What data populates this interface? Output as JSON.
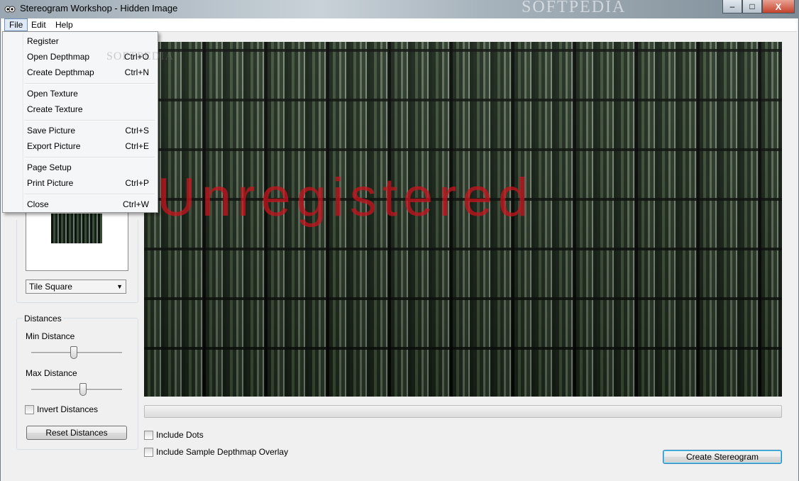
{
  "window": {
    "title": "Stereogram Workshop - Hidden Image",
    "watermark": "SOFTPEDIA",
    "min_glyph": "–",
    "max_glyph": "□",
    "close_glyph": "X"
  },
  "menubar": {
    "file": "File",
    "edit": "Edit",
    "help": "Help"
  },
  "file_menu": {
    "register": "Register",
    "open_depthmap": "Open Depthmap",
    "open_depthmap_sc": "Ctrl+O",
    "create_depthmap": "Create Depthmap",
    "create_depthmap_sc": "Ctrl+N",
    "open_texture": "Open Texture",
    "create_texture": "Create Texture",
    "save_picture": "Save Picture",
    "save_picture_sc": "Ctrl+S",
    "export_picture": "Export Picture",
    "export_picture_sc": "Ctrl+E",
    "page_setup": "Page Setup",
    "print_picture": "Print Picture",
    "print_picture_sc": "Ctrl+P",
    "close": "Close",
    "close_sc": "Ctrl+W"
  },
  "texture": {
    "tile_mode": "Tile Square"
  },
  "distances": {
    "legend": "Distances",
    "min_label": "Min Distance",
    "min_value": 0.47,
    "max_label": "Max Distance",
    "max_value": 0.58,
    "invert_label": "Invert Distances",
    "invert_checked": false,
    "reset_label": "Reset Distances"
  },
  "preview": {
    "watermark": "Unregistered",
    "progress": 0
  },
  "options": {
    "include_dots": "Include Dots",
    "include_dots_checked": false,
    "include_overlay": "Include Sample Depthmap Overlay",
    "include_overlay_checked": false
  },
  "actions": {
    "create": "Create Stereogram"
  },
  "colors": {
    "accent": "#3c7fb1",
    "watermark_red": "#c8141e"
  }
}
